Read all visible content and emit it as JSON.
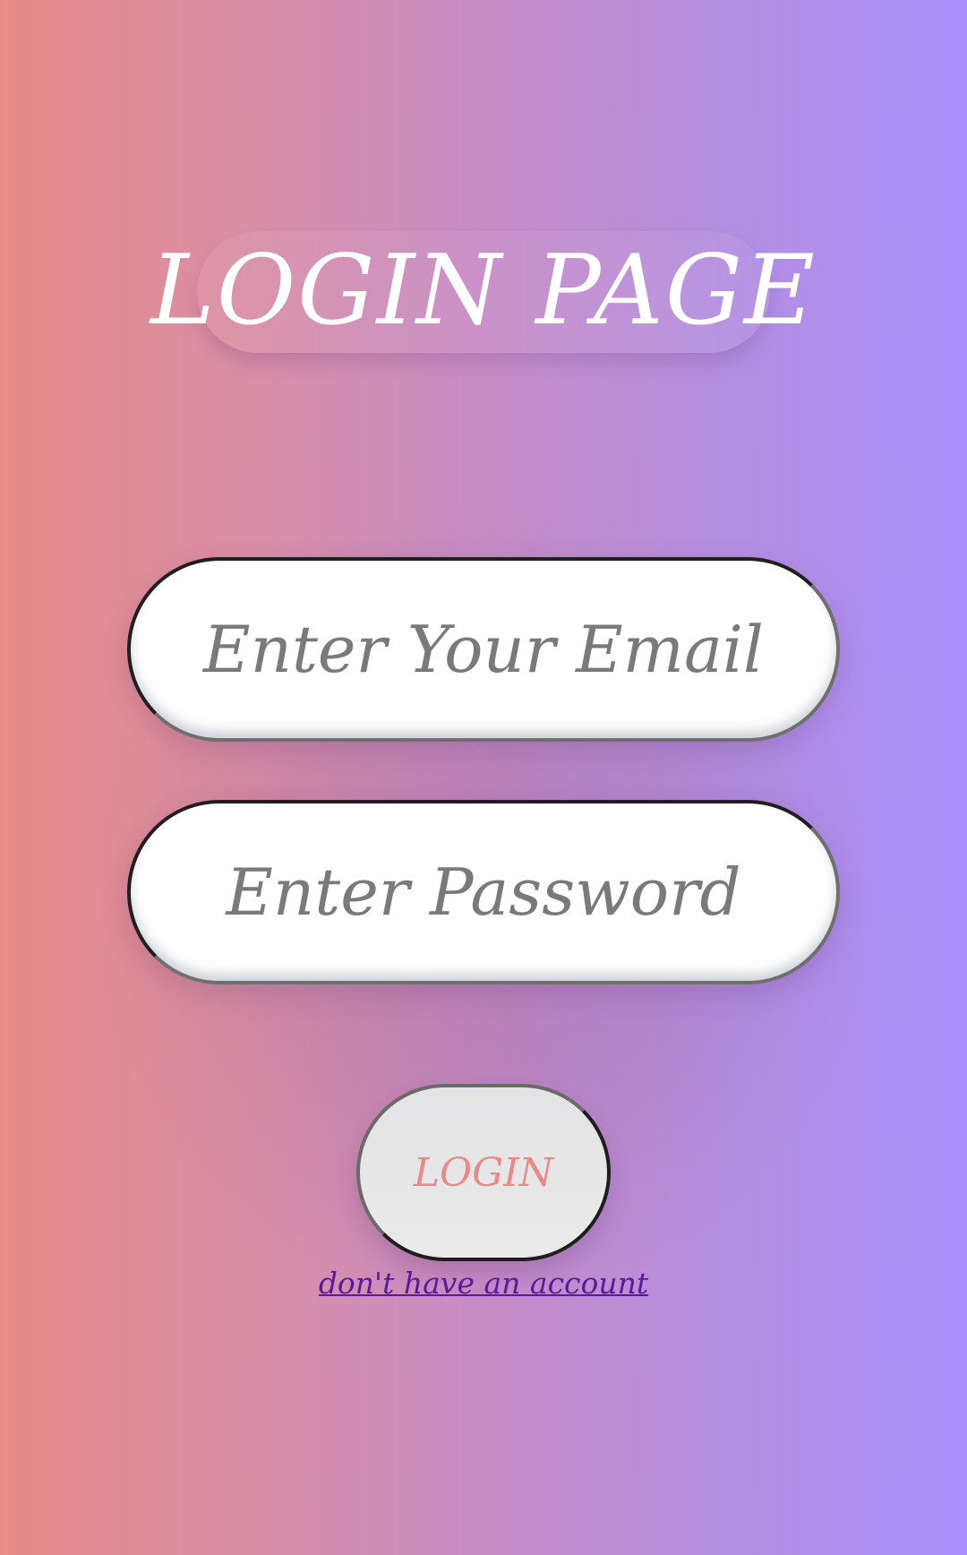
{
  "page": {
    "title": "LOGIN PAGE"
  },
  "form": {
    "email_placeholder": "Enter Your Email",
    "email_value": "",
    "password_placeholder": "Enter Password",
    "password_value": "",
    "login_label": "LOGIN",
    "signup_link_label": "don't have an account"
  },
  "colors": {
    "gradient_left": "#e88b88",
    "gradient_right": "#a890fc",
    "title_text": "#ffffff",
    "login_text": "#e88b88",
    "link_text": "#5b1a9a",
    "input_background": "#ffffff"
  }
}
